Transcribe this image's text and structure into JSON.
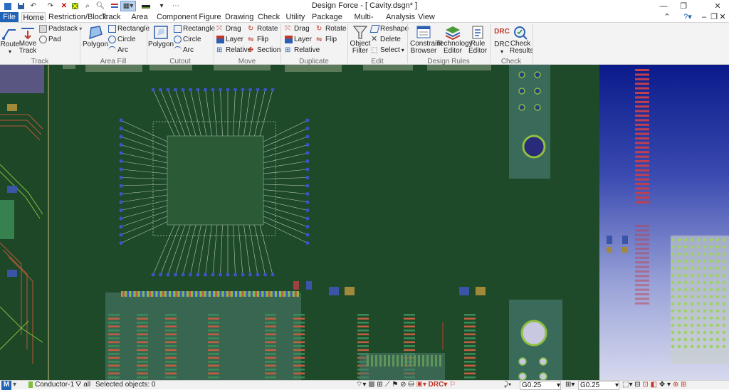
{
  "window": {
    "title": "Design Force - [ Cavity.dsgn* ]"
  },
  "tabs": [
    "File",
    "Home",
    "Restriction/Block",
    "Track",
    "Area Fill",
    "Component",
    "Figure",
    "Drawing",
    "Check",
    "Utility",
    "Package",
    "Multi-Board",
    "Analysis",
    "View"
  ],
  "ribbon": {
    "track": {
      "group": "Track",
      "route": "Route",
      "move_track": "Move Track",
      "padstack": "Padstack",
      "pad": "Pad"
    },
    "area_fill": {
      "group": "Area Fill",
      "polygon": "Polygon",
      "rectangle": "Rectangle",
      "circle": "Circle",
      "arc": "Arc"
    },
    "cutout": {
      "group": "Cutout",
      "polygon": "Polygon",
      "rectangle": "Rectangle",
      "circle": "Circle",
      "arc": "Arc"
    },
    "move": {
      "group": "Move",
      "drag": "Drag",
      "rotate": "Rotate",
      "layer": "Layer",
      "flip": "Flip",
      "relative": "Relative",
      "section": "Section"
    },
    "duplicate": {
      "group": "Duplicate",
      "drag": "Drag",
      "rotate": "Rotate",
      "layer": "Layer",
      "flip": "Flip",
      "relative": "Relative"
    },
    "edit": {
      "group": "Edit",
      "object_filter": "Object Filter",
      "reshape": "Reshape",
      "delete": "Delete",
      "select": "Select"
    },
    "design_rules": {
      "group": "Design Rules",
      "constraint_browser": "Constraint Browser",
      "technology_editor": "Technology Editor",
      "rule_editor": "Rule Editor"
    },
    "check": {
      "group": "Check",
      "drc": "DRC",
      "check_results": "Check Results"
    }
  },
  "status": {
    "layer": "Conductor-1",
    "filter": "all",
    "selected": "Selected objects: 0",
    "grid1": "G0.25",
    "grid2": "G0.25"
  },
  "colors": {
    "board": "#1e4a2a",
    "accent": "#1f63b6"
  }
}
